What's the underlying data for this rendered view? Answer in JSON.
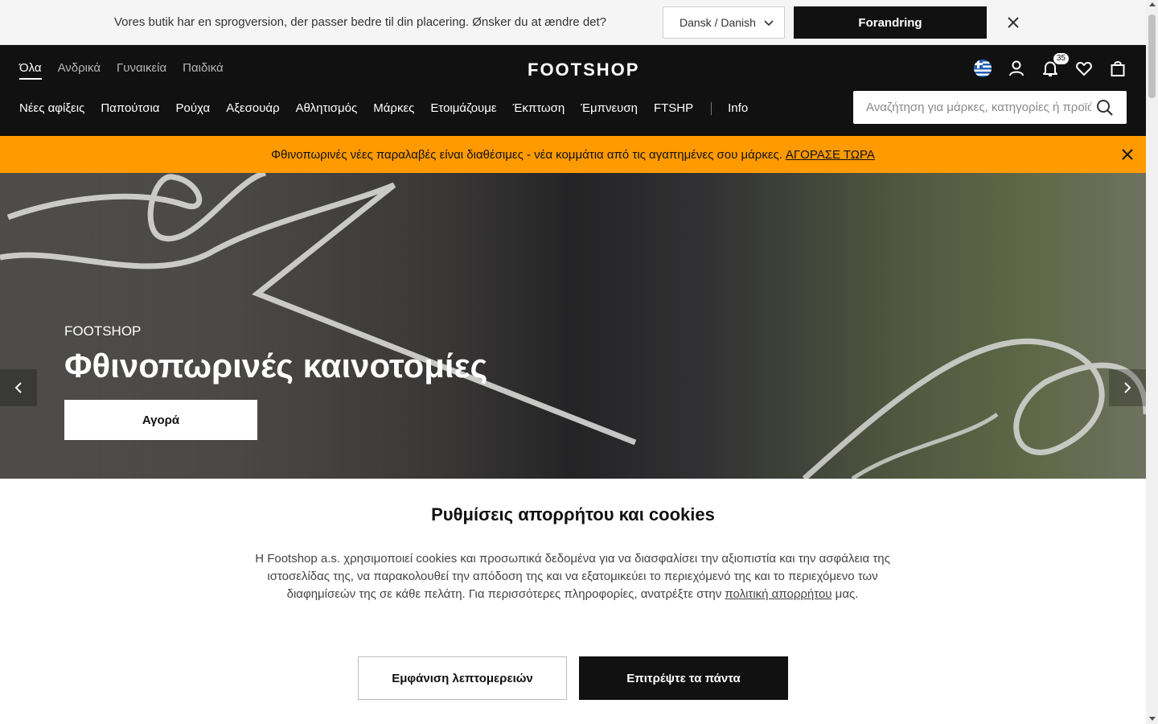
{
  "language_bar": {
    "message": "Vores butik har en sprogversion, der passer bedre til din placering. Ønsker du at ændre det?",
    "select_value": "Dansk / Danish",
    "change_label": "Forandring",
    "close_icon": "close-icon"
  },
  "header": {
    "gender_tabs": [
      "Όλα",
      "Ανδρικά",
      "Γυναικεία",
      "Παιδικά"
    ],
    "active_tab": "Όλα",
    "logo": "FOOTSHOP",
    "notification_count": "35",
    "icons": [
      "greece-flag-icon",
      "user-icon",
      "bell-icon",
      "heart-icon",
      "bag-icon"
    ],
    "categories": [
      "Νέες αφίξεις",
      "Παπούτσια",
      "Ρούχα",
      "Αξεσουάρ",
      "Αθλητισμός",
      "Μάρκες",
      "Ετοιμάζουμε",
      "Έκπτωση",
      "Έμπνευση",
      "FTSHP"
    ],
    "info_label": "Info",
    "search_placeholder": "Αναζήτηση για μάρκες, κατηγορίες ή προϊόντα"
  },
  "promo": {
    "text": "Φθινοπωρινές νέες παραλαβές είναι διαθέσιμες - νέα κομμάτια από τις αγαπημένες σου μάρκες.",
    "link": "ΑΓΟΡΑΣΕ ΤΩΡΑ",
    "color": "#ff9a00"
  },
  "hero": {
    "brand": "FOOTSHOP",
    "title": "Φθινοπωρινές καινοτομίες",
    "button": "Αγορά"
  },
  "cookies": {
    "title": "Ρυθμίσεις απορρήτου και cookies",
    "text_before": "Η Footshop a.s. χρησιμοποιεί cookies και προσωπικά δεδομένα για να διασφαλίσει την αξιοπιστία και την ασφάλεια της ιστοσελίδας της, να παρακολουθεί την απόδοση της και να εξατομικεύει το περιεχόμενό της και το περιεχόμενο των διαφημίσεών της σε κάθε πελάτη. Για περισσότερες πληροφορίες, ανατρέξτε στην",
    "link": "πολιτική απορρήτου",
    "text_after": "μας.",
    "details_button": "Εμφάνιση λεπτομερειών",
    "allow_button": "Επιτρέψτε τα πάντα"
  }
}
